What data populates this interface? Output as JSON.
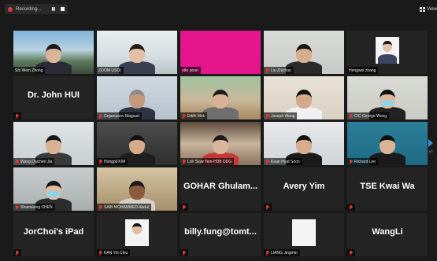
{
  "topbar": {
    "recording_label": "Recording...",
    "view_label": "View"
  },
  "pager": {
    "label": "1/2"
  },
  "participants": [
    {
      "name": "Shi Wein Zhong",
      "display": "",
      "muted": false
    },
    {
      "name": "ZOOM USOI",
      "display": "",
      "muted": false,
      "active": true
    },
    {
      "name": "otto poon",
      "display": "",
      "muted": false
    },
    {
      "name": "Liu Zhichao",
      "display": "",
      "muted": true
    },
    {
      "name": "Hengwei zhang",
      "display": "",
      "muted": false
    },
    {
      "name": "",
      "display": "Dr. John HUI",
      "muted": true
    },
    {
      "name": "Gojamanov Magsad",
      "display": "",
      "muted": true
    },
    {
      "name": "Edith Mok",
      "display": "",
      "muted": true
    },
    {
      "name": "Joseph Wang",
      "display": "",
      "muted": true
    },
    {
      "name": "CIC George Wong",
      "display": "",
      "muted": true
    },
    {
      "name": "Wang Daichen Jia",
      "display": "",
      "muted": true
    },
    {
      "name": "Hongpil KIM",
      "display": "",
      "muted": true
    },
    {
      "name": "Loh Siaw Yein-HDB DDG",
      "display": "",
      "muted": true
    },
    {
      "name": "Kean Huat Soon",
      "display": "",
      "muted": true
    },
    {
      "name": "Richard Lee",
      "display": "",
      "muted": true
    },
    {
      "name": "Shamsiong CHEN",
      "display": "",
      "muted": true
    },
    {
      "name": "SAIB MOHAMMED Abdul",
      "display": "",
      "muted": true
    },
    {
      "name": "",
      "display": "GOHAR Ghulam...",
      "muted": true
    },
    {
      "name": "",
      "display": "Avery Yim",
      "muted": true
    },
    {
      "name": "",
      "display": "TSE Kwai Wa",
      "muted": true
    },
    {
      "name": "",
      "display": "JorChoi's iPad",
      "muted": true
    },
    {
      "name": "KAN Yin Chiu",
      "display": "",
      "muted": true
    },
    {
      "name": "",
      "display": "billy.fung@tomt...",
      "muted": true
    },
    {
      "name": "LIANG Jingmin",
      "display": "",
      "muted": true
    },
    {
      "name": "",
      "display": "WangLi",
      "muted": true
    }
  ],
  "colors": {
    "window_bg": "#1a1a1a",
    "tile_bg": "#232323",
    "active_speaker": "#d4e043",
    "muted_mic": "#e53935",
    "next_arrow": "#3a8fd9"
  },
  "icons": {
    "recording": "red-dot-icon",
    "pause": "pause-icon",
    "stop": "stop-icon",
    "view": "grid-view-icon",
    "mic_muted": "mic-muted-icon",
    "next_page": "chevron-right-icon"
  }
}
